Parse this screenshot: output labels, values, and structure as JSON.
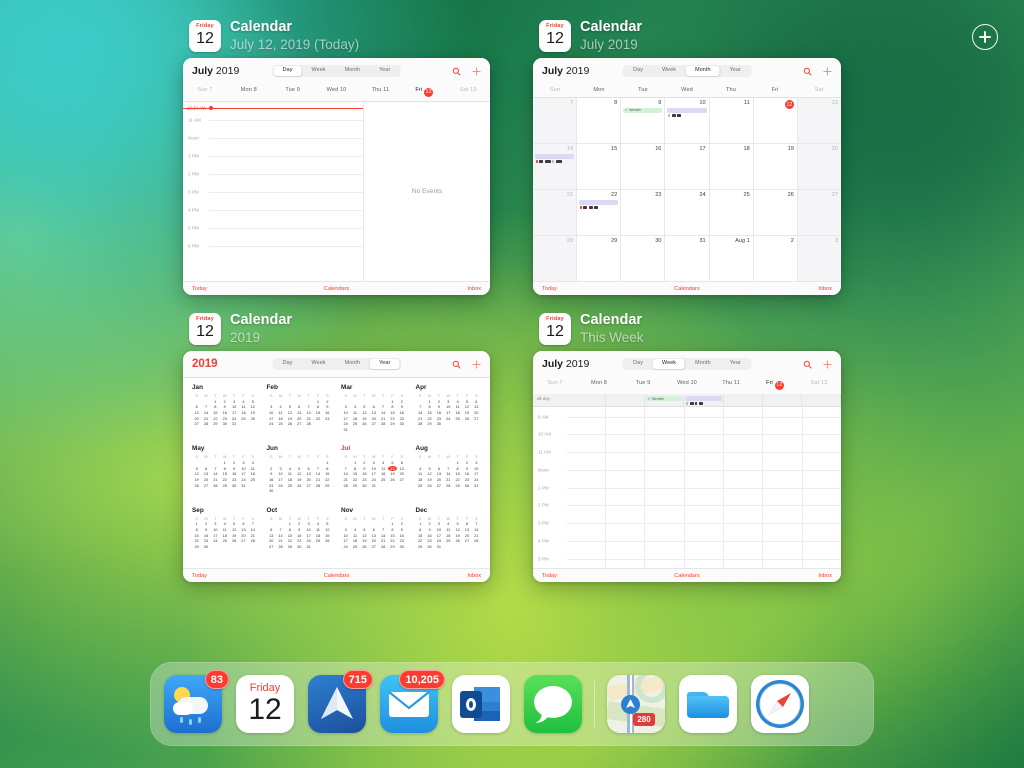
{
  "screen": {
    "title": "iPad App Switcher",
    "plus_button": "add-window"
  },
  "cards": [
    {
      "icon": {
        "dow": "Friday",
        "day": "12"
      },
      "app": "Calendar",
      "subtitle": "July 12, 2019 (Today)",
      "view": "day",
      "cal_title_bold": "July",
      "cal_title_light": " 2019",
      "segments": [
        "Day",
        "Week",
        "Month",
        "Year"
      ],
      "segment_selected": "Day",
      "weekdays": [
        "Sun 7",
        "Mon 8",
        "Tue 9",
        "Wed 10",
        "Thu 11",
        "Fri",
        "Sat 13"
      ],
      "today_label": "12",
      "now_label": "10:34 AM",
      "hours": [
        "11 AM",
        "Noon",
        "1 PM",
        "2 PM",
        "3 PM",
        "4 PM",
        "5 PM",
        "6 PM"
      ],
      "no_events": "No Events",
      "footer": {
        "left": "Today",
        "center": "Calendars",
        "right": "Inbox"
      }
    },
    {
      "icon": {
        "dow": "Friday",
        "day": "12"
      },
      "app": "Calendar",
      "subtitle": "July 2019",
      "view": "month",
      "cal_title_bold": "July",
      "cal_title_light": " 2019",
      "segments": [
        "Day",
        "Week",
        "Month",
        "Year"
      ],
      "segment_selected": "Month",
      "weekdays": [
        "Sun",
        "Mon",
        "Tue",
        "Wed",
        "Thu",
        "Fri",
        "Sat"
      ],
      "today_label": "12",
      "footer": {
        "left": "Today",
        "center": "Calendars",
        "right": "Inbox"
      },
      "weeks": [
        [
          "7",
          "8",
          "9",
          "10",
          "11",
          "12",
          "13"
        ],
        [
          "14",
          "15",
          "16",
          "17",
          "18",
          "19",
          "20"
        ],
        [
          "21",
          "22",
          "23",
          "24",
          "25",
          "26",
          "27"
        ],
        [
          "28",
          "29",
          "30",
          "31",
          "Aug 1",
          "2",
          "3"
        ]
      ]
    },
    {
      "icon": {
        "dow": "Friday",
        "day": "12"
      },
      "app": "Calendar",
      "subtitle": "2019",
      "view": "year",
      "cal_title_year": "2019",
      "segments": [
        "Day",
        "Week",
        "Month",
        "Year"
      ],
      "segment_selected": "Year",
      "dow_initials": [
        "S",
        "M",
        "T",
        "W",
        "T",
        "F",
        "S"
      ],
      "current_month": "Jul",
      "today_label": "12",
      "months": [
        {
          "name": "Jan",
          "start": 2,
          "days": 31
        },
        {
          "name": "Feb",
          "start": 5,
          "days": 28
        },
        {
          "name": "Mar",
          "start": 5,
          "days": 31
        },
        {
          "name": "Apr",
          "start": 1,
          "days": 30
        },
        {
          "name": "May",
          "start": 3,
          "days": 31
        },
        {
          "name": "Jun",
          "start": 6,
          "days": 30
        },
        {
          "name": "Jul",
          "start": 1,
          "days": 31
        },
        {
          "name": "Aug",
          "start": 4,
          "days": 31
        },
        {
          "name": "Sep",
          "start": 0,
          "days": 30
        },
        {
          "name": "Oct",
          "start": 2,
          "days": 31
        },
        {
          "name": "Nov",
          "start": 5,
          "days": 30
        },
        {
          "name": "Dec",
          "start": 0,
          "days": 31
        }
      ],
      "footer": {
        "left": "Today",
        "center": "Calendars",
        "right": "Inbox"
      }
    },
    {
      "icon": {
        "dow": "Friday",
        "day": "12"
      },
      "app": "Calendar",
      "subtitle": "This Week",
      "view": "week",
      "cal_title_bold": "July",
      "cal_title_light": " 2019",
      "segments": [
        "Day",
        "Week",
        "Month",
        "Year"
      ],
      "segment_selected": "Week",
      "weekdays": [
        "Sun 7",
        "Mon 8",
        "Tue 9",
        "Wed 10",
        "Thu 11",
        "Fri",
        "Sat 13"
      ],
      "today_label": "12",
      "allday_label": "all-day",
      "hours": [
        "9 AM",
        "10 AM",
        "11 AM",
        "Noon",
        "1 PM",
        "2 PM",
        "3 PM",
        "4 PM",
        "5 PM"
      ],
      "footer": {
        "left": "Today",
        "center": "Calendars",
        "right": "Inbox"
      }
    }
  ],
  "dock": {
    "items": [
      {
        "name": "Weather",
        "icon": "weather-icon",
        "badge": "83"
      },
      {
        "name": "Calendar",
        "icon": "calendar-icon",
        "dow": "Friday",
        "day": "12"
      },
      {
        "name": "Spark",
        "icon": "spark-icon",
        "badge": "715"
      },
      {
        "name": "Mail",
        "icon": "mail-icon",
        "badge": "10,205"
      },
      {
        "name": "Outlook",
        "icon": "outlook-icon"
      },
      {
        "name": "Messages",
        "icon": "messages-icon"
      },
      {
        "name": "Maps",
        "icon": "maps-icon",
        "shield": "280"
      },
      {
        "name": "Files",
        "icon": "files-icon"
      },
      {
        "name": "Safari",
        "icon": "safari-icon"
      }
    ]
  },
  "colors": {
    "accent_red": "#fb3b30",
    "badge_red": "#ff3b30",
    "event_green": "#d6f0d8",
    "event_purple": "#ded9f2"
  }
}
